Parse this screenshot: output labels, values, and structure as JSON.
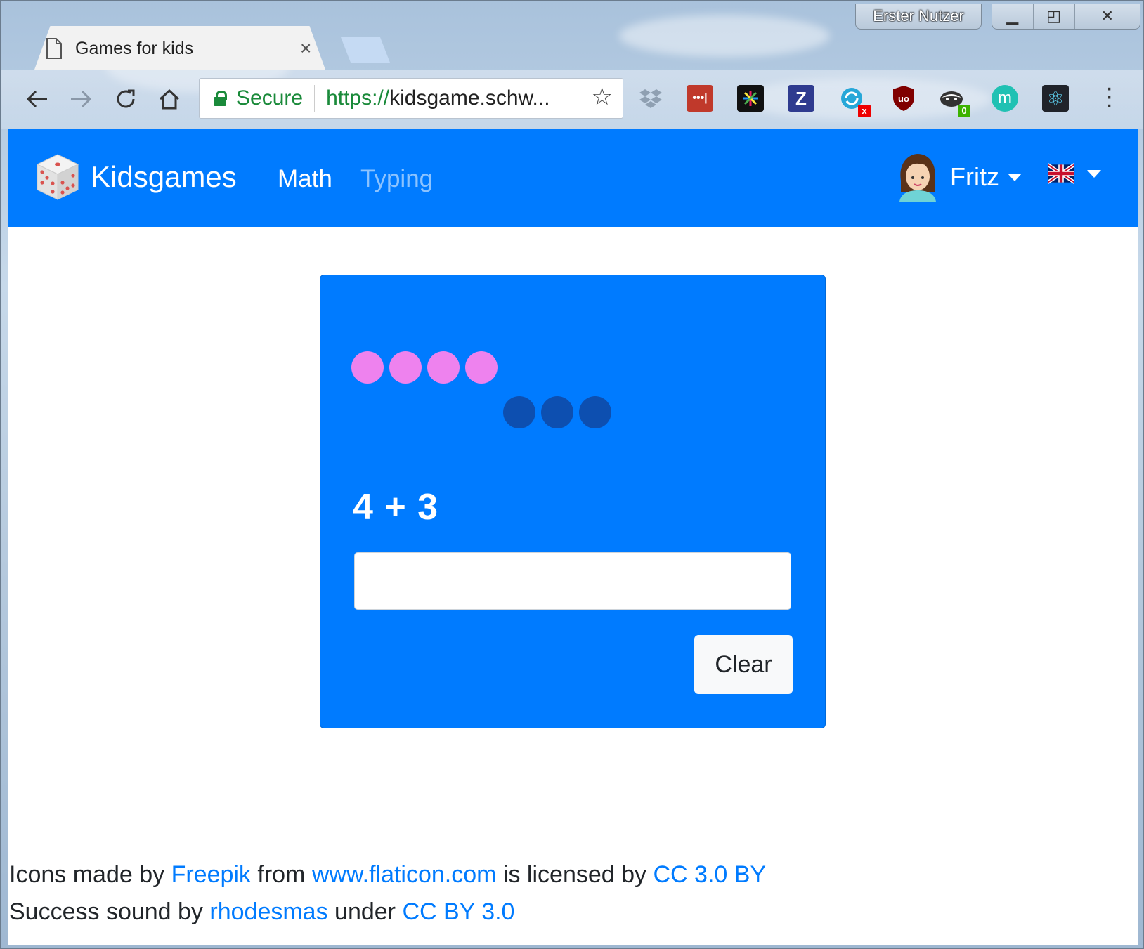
{
  "browser": {
    "profile_name": "Erster Nutzer",
    "tab_title": "Games for kids",
    "tab_close": "×",
    "omnibox": {
      "secure_label": "Secure",
      "url_scheme": "https://",
      "url_rest": "kidsgame.schw..."
    },
    "extensions": [
      {
        "name": "dropbox-icon"
      },
      {
        "name": "lastpass-icon",
        "label": "•••|"
      },
      {
        "name": "colorful-spark-icon"
      },
      {
        "name": "zotero-icon",
        "label": "Z"
      },
      {
        "name": "sync-icon",
        "badge": "x"
      },
      {
        "name": "ublock-icon",
        "label": "uo"
      },
      {
        "name": "privacy-badger-icon",
        "badge": "0"
      },
      {
        "name": "m-icon",
        "label": "m"
      },
      {
        "name": "react-devtools-icon",
        "label": "⚛"
      }
    ]
  },
  "navbar": {
    "brand": "Kidsgames",
    "links": [
      "Math",
      "Typing"
    ],
    "user_name": "Fritz"
  },
  "game": {
    "first_count": 4,
    "second_count": 3,
    "first_color": "#ee82ee",
    "second_color": "#0d4fb0",
    "equation": "4 + 3",
    "answer_value": "",
    "clear_label": "Clear"
  },
  "footer": {
    "line1": {
      "t1": "Icons made by ",
      "link1": "Freepik",
      "t2": " from ",
      "link2": "www.flaticon.com",
      "t3": " is licensed by ",
      "link3": "CC 3.0 BY"
    },
    "line2": {
      "t1": "Success sound by ",
      "link1": "rhodesmas",
      "t2": " under ",
      "link2": "CC BY 3.0"
    }
  },
  "colors": {
    "primary": "#007bff",
    "secure_green": "#1a8a3a"
  }
}
